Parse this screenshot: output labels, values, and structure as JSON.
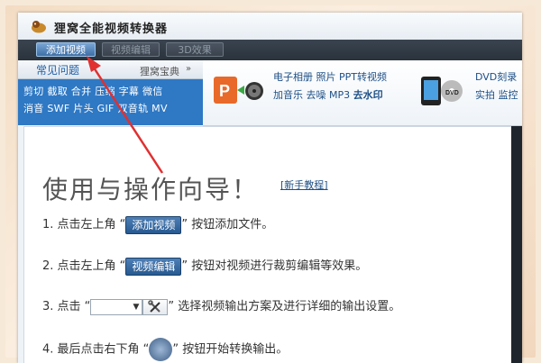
{
  "app": {
    "title": "狸窝全能视频转换器"
  },
  "toolbar": {
    "add_video": "添加视频",
    "edit_video": "视频编辑",
    "effect_3d": "3D效果"
  },
  "sidebar": {
    "faq": "常见问题",
    "guide": "狸窝宝典",
    "line1": "剪切 截取 合并 压缩 字幕 微信",
    "line2": "消音 SWF 片头 GIF 双音轨 MV"
  },
  "promo": {
    "ppt_line1": "电子相册 照片 PPT转视频",
    "ppt_line2_a": "加音乐 去噪 MP3 ",
    "ppt_line2_b": "去水印",
    "dvd_line1": "DVD刻录",
    "dvd_line2": "实拍 监控"
  },
  "guide": {
    "title": "使用与操作向导！",
    "newbie": "[新手教程]",
    "step1_pre": "1. 点击左上角 “",
    "step1_btn": "添加视频",
    "step1_post": "” 按钮添加文件。",
    "step2_pre": "2. 点击左上角 “",
    "step2_btn": "视频编辑",
    "step2_post": "” 按钮对视频进行裁剪编辑等效果。",
    "step3_pre": "3. 点击 “",
    "step3_post": "” 选择视频输出方案及进行详细的输出设置。",
    "step4_pre": "4. 最后点击右下角 “",
    "step4_post": "” 按钮开始转换输出。"
  },
  "colors": {
    "toolbar": "#2f3943",
    "sidebar": "#2e78c4",
    "annotation_arrow": "#e03030"
  }
}
